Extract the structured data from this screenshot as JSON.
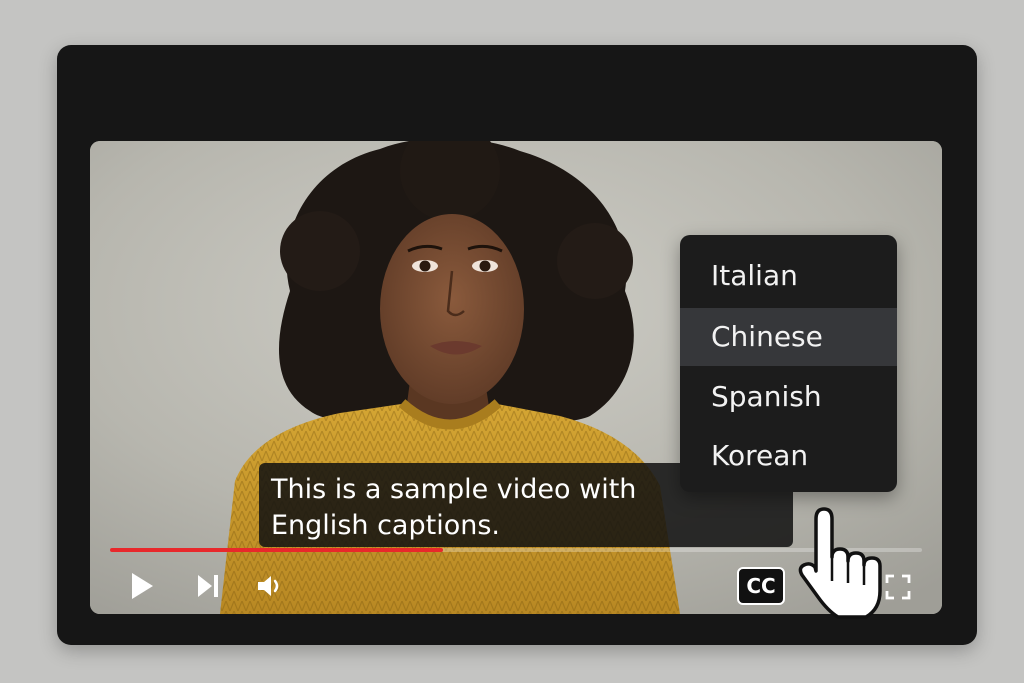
{
  "video": {
    "caption_lines": [
      "This is a sample video with",
      "English captions."
    ],
    "progress_fraction": 0.41
  },
  "controls": {
    "play_icon": "play-icon",
    "next_icon": "skip-next-icon",
    "volume_icon": "volume-icon",
    "cc_label": "CC",
    "fullscreen_icon": "fullscreen-icon"
  },
  "caption_menu": {
    "items": [
      "Italian",
      "Chinese",
      "Spanish",
      "Korean"
    ],
    "highlighted": "Chinese"
  },
  "colors": {
    "progress": "#e8282b",
    "sweater": "#c99a2c",
    "menu_bg": "#1c1c1c",
    "menu_highlight": "#36373a"
  }
}
